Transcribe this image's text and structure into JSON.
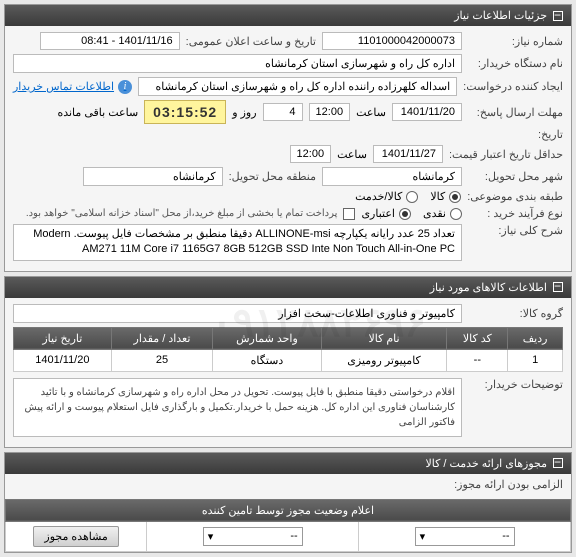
{
  "panel1": {
    "title": "جزئیات اطلاعات نیاز",
    "need_no_label": "شماره نیاز:",
    "need_no": "1101000042000073",
    "announce_label": "تاریخ و ساعت اعلان عمومی:",
    "announce_value": "1401/11/16 - 08:41",
    "buyer_label": "نام دستگاه خریدار:",
    "buyer_value": "اداره کل راه و شهرسازی استان کرمانشاه",
    "creator_label": "ایجاد کننده درخواست:",
    "creator_value": "اسداله کلهرزاده راننده اداره کل راه و شهرسازی استان کرمانشاه",
    "contact_link": "اطلاعات تماس خریدار",
    "deadline_label": "مهلت ارسال پاسخ:",
    "deadline_date": "1401/11/20",
    "time_word": "ساعت",
    "deadline_time": "12:00",
    "days_value": "4",
    "days_word": "روز و",
    "countdown": "03:15:52",
    "remain_word": "ساعت باقی مانده",
    "date_label": "تاریخ:",
    "min_credit_label": "حداقل تاریخ اعتبار قیمت:",
    "min_credit_date": "1401/11/27",
    "min_credit_time": "12:00",
    "deliver_city_label": "شهر محل تحویل:",
    "deliver_city": "کرمانشاه",
    "deliver_region_label": "منطقه محل تحویل:",
    "deliver_region": "کرمانشاه",
    "unit_method_label": "طبقه بندی موضوعی:",
    "radio_goods": "کالا",
    "radio_service": "کالا/خدمت",
    "process_label": "نوع فرآیند خرید :",
    "radio_cash": "نقدی",
    "radio_credit": "اعتباری",
    "pay_note": "پرداخت تمام یا بخشی از مبلغ خرید،از محل \"اسناد خزانه اسلامی\" خواهد بود.",
    "desc_label": "شرح کلی نیاز:",
    "desc_value": "تعداد 25 عدد رایانه یکپارچه ALLINONE-msi دقیقا منطبق بر مشخصات فایل پیوست. Modern AM271 11M Core i7 1165G7 8GB 512GB SSD Inte Non Touch All-in-One PC"
  },
  "panel2": {
    "title": "اطلاعات کالاهای مورد نیاز",
    "group_label": "گروه کالا:",
    "group_value": "کامپیوتر و فناوری اطلاعات-سخت افزار",
    "cols": {
      "row": "ردیف",
      "code": "کد کالا",
      "name": "نام کالا",
      "unit": "واحد شمارش",
      "qty": "تعداد / مقدار",
      "date": "تاریخ نیاز"
    },
    "rows": [
      {
        "row": "1",
        "code": "--",
        "name": "کامپیوتر رومیزی",
        "unit": "دستگاه",
        "qty": "25",
        "date": "1401/11/20"
      }
    ],
    "buyer_notes_label": "توضیحات خریدار:",
    "buyer_notes": "اقلام درخواستی دقیقا منطبق با فایل پیوست. تحویل در محل اداره راه و شهرسازی کرمانشاه و با تائید کارشناسان فناوری این اداره کل. هزینه حمل با خریدار.تکمیل و بارگذاری فایل استعلام پیوست و ارائه پیش فاکتور الزامی"
  },
  "panel3": {
    "title": "مجوزهای ارائه خدمت / کالا",
    "mandatory_label": "الزامی بودن ارائه مجوز:",
    "status_header": "اعلام وضعیت مجوز توسط تامین کننده",
    "select_value": "--",
    "select2_value": "--",
    "view_btn": "مشاهده مجوز"
  }
}
